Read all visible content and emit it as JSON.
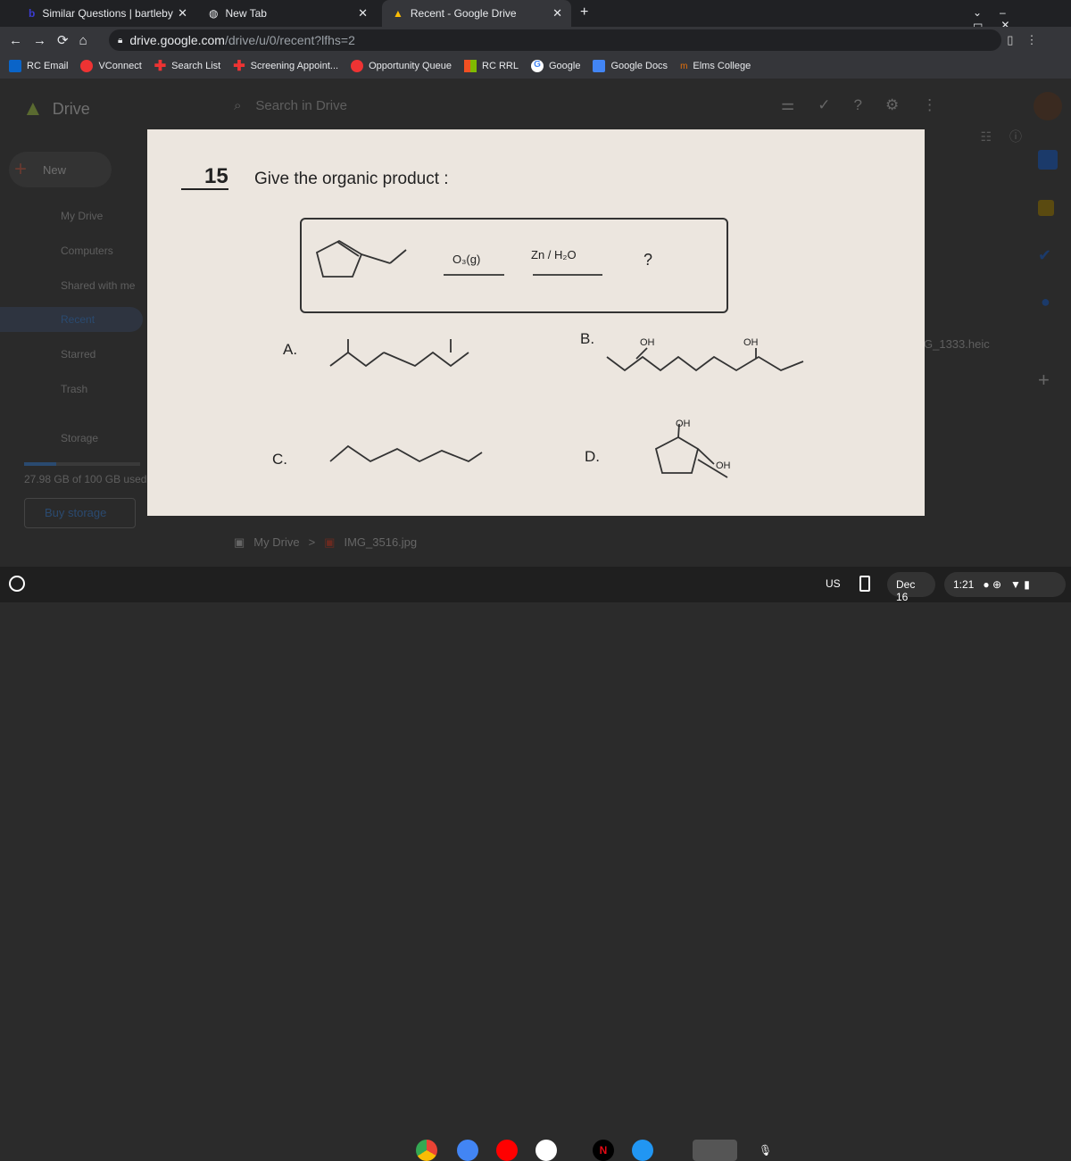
{
  "browser": {
    "tabs": [
      {
        "title": "Similar Questions | bartleby",
        "active": false
      },
      {
        "title": "New Tab",
        "active": false
      },
      {
        "title": "Recent - Google Drive",
        "active": true
      }
    ],
    "url_host": "drive.google.com",
    "url_path": "/drive/u/0/recent?lfhs=2",
    "bookmarks": [
      "RC Email",
      "VConnect",
      "Search List",
      "Screening Appoint...",
      "Opportunity Queue",
      "RC RRL",
      "Google",
      "Google Docs",
      "Elms College"
    ]
  },
  "drive": {
    "logo": "Drive",
    "search_placeholder": "Search in Drive",
    "new_label": "New",
    "nav": [
      "My Drive",
      "Computers",
      "Shared with me",
      "Recent",
      "Starred",
      "Trash",
      "Storage"
    ],
    "storage_text": "27.98 GB of 100 GB used",
    "storage_fraction": 0.28,
    "buy_storage": "Buy storage",
    "side_file": "G_1333.heic",
    "breadcrumb": {
      "root": "My Drive",
      "file": "IMG_3516.jpg"
    }
  },
  "photo": {
    "number": "15",
    "prompt": "Give the organic product :",
    "reagent1": "O₃(g)",
    "reagent2": "Zn / H₂O",
    "unknown": "?",
    "labels": [
      "A.",
      "B.",
      "C.",
      "D."
    ],
    "oh": "OH"
  },
  "shelf": {
    "locale": "US",
    "date": "Dec 16",
    "time": "1:21"
  }
}
